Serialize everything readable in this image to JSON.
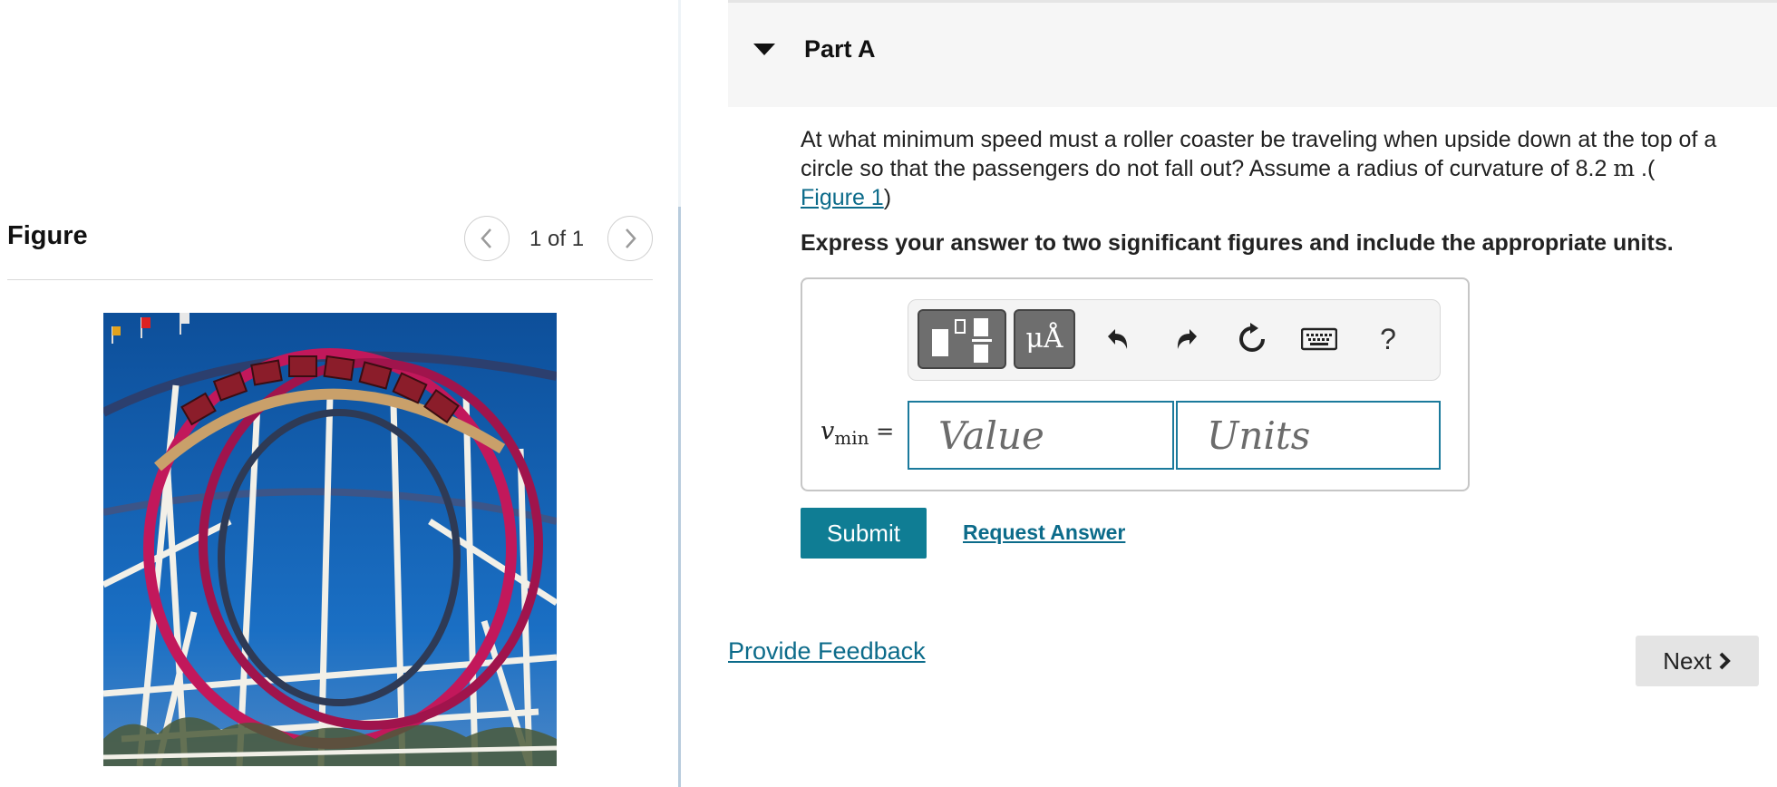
{
  "figure_panel": {
    "title": "Figure",
    "counter": "1 of 1",
    "prev_icon": "chevron-left-icon",
    "next_icon": "chevron-right-icon",
    "image_subject": "roller coaster loops against blue sky"
  },
  "part": {
    "title": "Part A",
    "caret_icon": "caret-down-icon"
  },
  "question": {
    "text_before_unit": "At what minimum speed must a roller coaster be traveling when upside down at the top of a circle so that the passengers do not fall out? Assume a radius of curvature of 8.2 ",
    "unit": "m",
    "text_after_unit": " .(",
    "figure_link": "Figure 1",
    "closing": ")",
    "instruction": "Express your answer to two significant figures and include the appropriate units."
  },
  "toolbar": {
    "units_label": "μÅ",
    "help_label": "?",
    "icons": [
      "templates-icon",
      "units-icon",
      "undo-icon",
      "redo-icon",
      "reset-icon",
      "keyboard-icon",
      "help-icon"
    ]
  },
  "answer": {
    "var_symbol": "v",
    "var_subscript": "min",
    "equals": "=",
    "value_placeholder": "Value",
    "units_placeholder": "Units"
  },
  "actions": {
    "submit_label": "Submit",
    "request_answer_label": "Request Answer",
    "feedback_label": "Provide Feedback",
    "next_label": "Next"
  },
  "colors": {
    "accent": "#0f7d94",
    "link": "#0c6b8a",
    "input_border": "#1b7a9c"
  }
}
